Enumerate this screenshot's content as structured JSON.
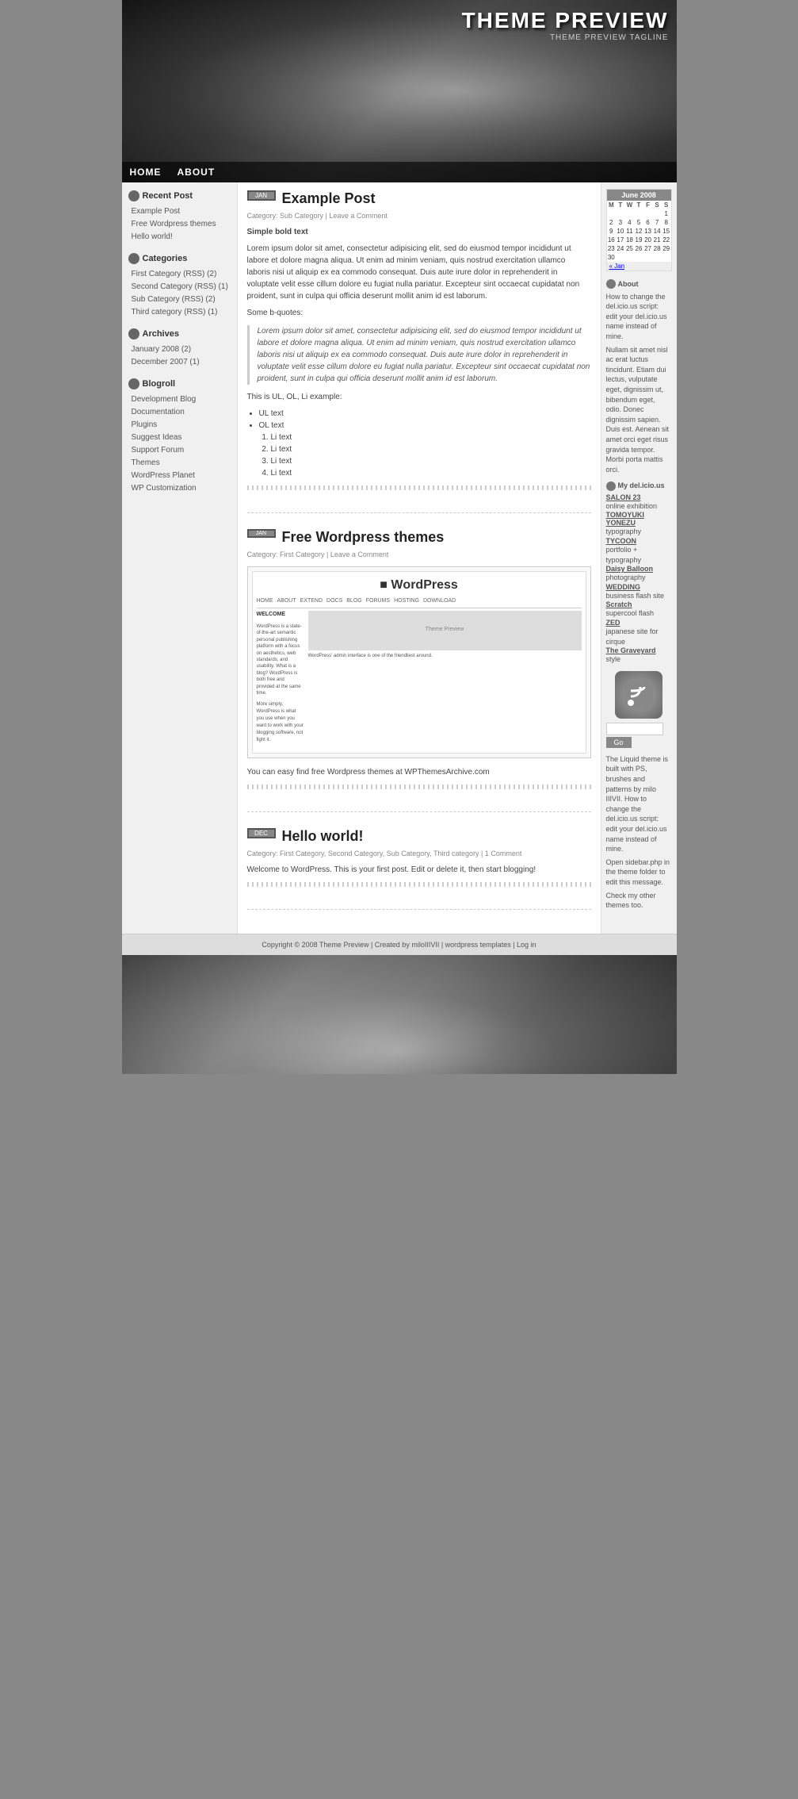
{
  "header": {
    "title": "THEME PREVIEW",
    "tagline": "THEME PREVIEW TAGLINE",
    "nav": [
      {
        "label": "HOME",
        "href": "#"
      },
      {
        "label": "ABOUT",
        "href": "#"
      }
    ]
  },
  "sidebar_left": {
    "sections": [
      {
        "title": "Recent Post",
        "items": [
          {
            "label": "Example Post"
          },
          {
            "label": "Free Wordpress themes"
          },
          {
            "label": "Hello world!"
          }
        ]
      },
      {
        "title": "Categories",
        "items": [
          {
            "label": "First Category (RSS) (2)"
          },
          {
            "label": "Second Category (RSS) (1)"
          },
          {
            "label": "Sub Category (RSS) (2)"
          },
          {
            "label": "Third category (RSS) (1)"
          }
        ]
      },
      {
        "title": "Archives",
        "items": [
          {
            "label": "January 2008 (2)"
          },
          {
            "label": "December 2007 (1)"
          }
        ]
      },
      {
        "title": "Blogroll",
        "items": [
          {
            "label": "Development Blog"
          },
          {
            "label": "Documentation"
          },
          {
            "label": "Plugins"
          },
          {
            "label": "Suggest Ideas"
          },
          {
            "label": "Support Forum"
          },
          {
            "label": "Themes"
          },
          {
            "label": "WordPress Planet"
          },
          {
            "label": "WP Customization"
          }
        ]
      }
    ]
  },
  "posts": [
    {
      "id": "example-post",
      "date_month": "JAN",
      "date_day": "",
      "title": "Example Post",
      "meta": "Category: Sub Category | Leave a Comment",
      "bold_text": "Simple bold text",
      "body": "Lorem ipsum dolor sit amet, consectetur adipisicing elit, sed do eiusmod tempor incididunt ut labore et dolore magna aliqua. Ut enim ad minim veniam, quis nostrud exercitation ullamco laboris nisi ut aliquip ex ea commodo consequat. Duis aute irure dolor in reprehenderit in voluptate velit esse cillum dolore eu fugiat nulla pariatur. Excepteur sint occaecat cupidatat non proident, sunt in culpa qui officia deserunt mollit anim id est laborum.",
      "bquote_label": "Some b-quotes:",
      "blockquote": "Lorem ipsum dolor sit amet, consectetur adipisicing elit, sed do eiusmod tempor incididunt ut labore et dolore magna aliqua. Ut enim ad minim veniam, quis nostrud exercitation ullamco laboris nisi ut aliquip ex ea commodo consequat. Duis aute irure dolor in reprehenderit in voluptate velit esse cillum dolore eu fugiat nulla pariatur. Excepteur sint occaecat cupidatat non proident, sunt in culpa qui officia deserunt mollit anim id est laborum.",
      "ul_label": "This is UL, OL, Li example:",
      "ul_items": [
        "UL text",
        "OL text"
      ],
      "li_items": [
        "Li text",
        "Li text",
        "Li text",
        "Li text"
      ]
    },
    {
      "id": "free-wordpress",
      "date_month": "",
      "date_day": "",
      "title": "Free Wordpress themes",
      "meta": "Category: First Category | Leave a Comment",
      "wp_text": "You can easy find free Wordpress themes at WPThemesArchive.com"
    },
    {
      "id": "hello-world",
      "date_month": "DEC",
      "date_day": "",
      "title": "Hello world!",
      "meta": "Category: First Category, Second Category, Sub Category, Third category | 1 Comment",
      "body": "Welcome to WordPress. This is your first post. Edit or delete it, then start blogging!"
    }
  ],
  "calendar": {
    "month": "June 2008",
    "days_header": [
      "M",
      "T",
      "W",
      "T",
      "F",
      "S",
      "S"
    ],
    "weeks": [
      [
        "",
        "",
        "",
        "",
        "",
        "",
        "1"
      ],
      [
        "2",
        "3",
        "4",
        "5",
        "6",
        "7",
        "8"
      ],
      [
        "9",
        "10",
        "11",
        "12",
        "13",
        "14",
        "15"
      ],
      [
        "16",
        "17",
        "18",
        "19",
        "20",
        "21",
        "22"
      ],
      [
        "23",
        "24",
        "25",
        "26",
        "27",
        "28",
        "29"
      ],
      [
        "30",
        "",
        "",
        "",
        "",
        "",
        ""
      ]
    ],
    "prev": "« Jan"
  },
  "sidebar_right": {
    "about_title": "About",
    "about_text": "How to change the del.icio.us script: edit your del.icio.us name instead of mine.",
    "about_text2": "Nullam sit amet nisl ac erat luctus tincidunt. Etiam dui lectus, vulputate eget, dignissim ut, bibendum eget, odio. Donec dignissim sapien. Duis est. Aenean sit amet orci eget risus gravida tempor. Morbi porta mattis orci.",
    "delicious_title": "My del.icio.us",
    "delicious_items": [
      {
        "name": "SALON 23",
        "sub": "online exhibition"
      },
      {
        "name": "TOMOYUKI YONEZU",
        "sub": "typography"
      },
      {
        "name": "TYCOON",
        "sub": "portfolio + typography"
      },
      {
        "name": "Daisy Balloon",
        "sub": "photography"
      },
      {
        "name": "WEDDING",
        "sub": "business flash site"
      },
      {
        "name": "Scratch",
        "sub": "supercool flash"
      },
      {
        "name": "ZED",
        "sub": "japanese site for cirque"
      },
      {
        "name": "The Graveyard",
        "sub": "style"
      }
    ],
    "search_placeholder": "",
    "search_button": "Go",
    "bottom_text": "The Liquid theme is built with PS, brushes and patterns by milo IIIVII. How to change the del.icio.us script: edit your del.icio.us name instead of mine.",
    "bottom_text2": "Open sidebar.php in the theme folder to edit this message.",
    "bottom_text3": "Check my other themes too."
  },
  "footer": {
    "text": "Copyright © 2008 Theme Preview | Created by miloIIIVII | wordpress templates | Log in"
  }
}
